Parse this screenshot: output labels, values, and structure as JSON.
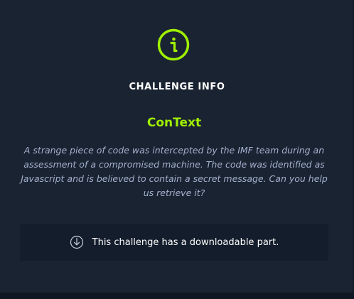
{
  "challenge": {
    "section_heading": "CHALLENGE INFO",
    "name": "ConText",
    "description": "A strange piece of code was intercepted by the IMF team during an assessment of a compromised machine. The code was identified as Javascript and is believed to contain a secret message. Can you help us retrieve it?",
    "download_notice": "This challenge has a downloadable part."
  },
  "icons": {
    "info": "info-circle-icon",
    "download": "download-circle-icon"
  },
  "colors": {
    "background": "#1a2332",
    "accent": "#9fef00",
    "description_text": "#a4b1cd",
    "download_box": "#141d2b"
  }
}
